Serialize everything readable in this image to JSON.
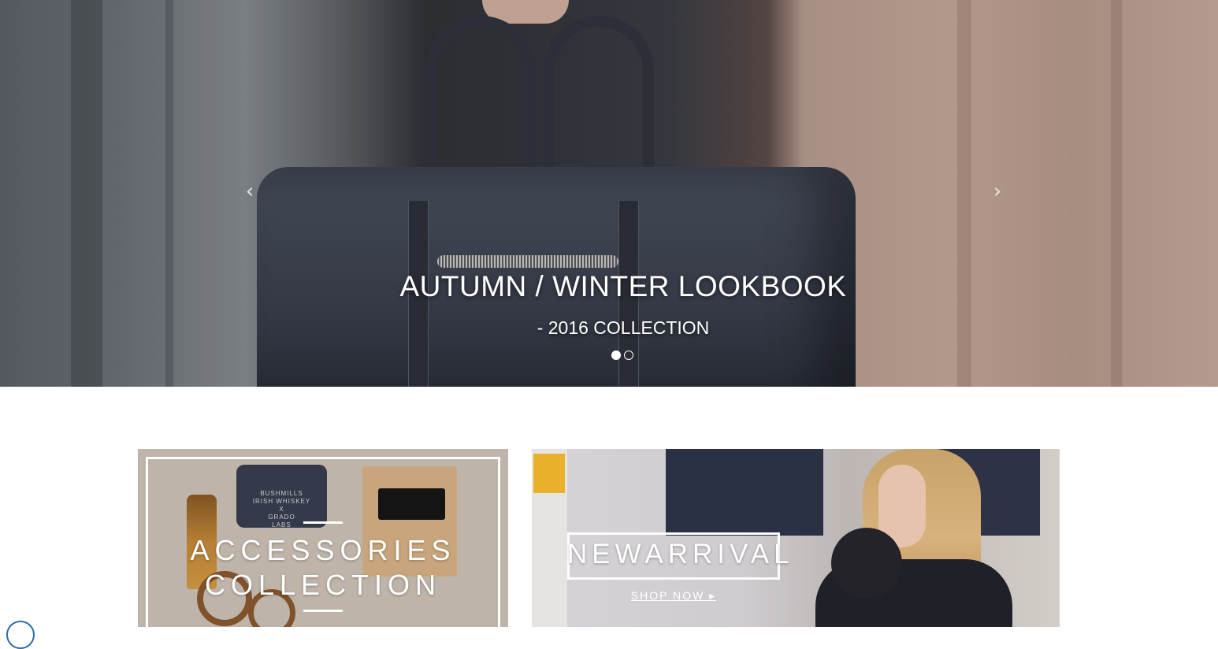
{
  "hero": {
    "title": "AUTUMN / WINTER LOOKBOOK",
    "subtitle": "- 2016 COLLECTION",
    "prev_arrow": "‹",
    "next_arrow": "›",
    "slides_count": 2,
    "active_slide": 1
  },
  "banners": {
    "accessories": {
      "title_line1": "ACCESSORIES",
      "title_line2": "COLLECTION",
      "product_label_1": "BUSHMILLS",
      "product_label_2": "IRISH WHISKEY",
      "product_label_3": "X",
      "product_label_4": "GRADO",
      "product_label_5": "LABS"
    },
    "new_arrival": {
      "title": "NEWARRIVAL",
      "cta": "SHOP NOW ▸"
    }
  },
  "colors": {
    "accent": "#ffffff",
    "chat_badge_border": "#2d6ba8"
  }
}
